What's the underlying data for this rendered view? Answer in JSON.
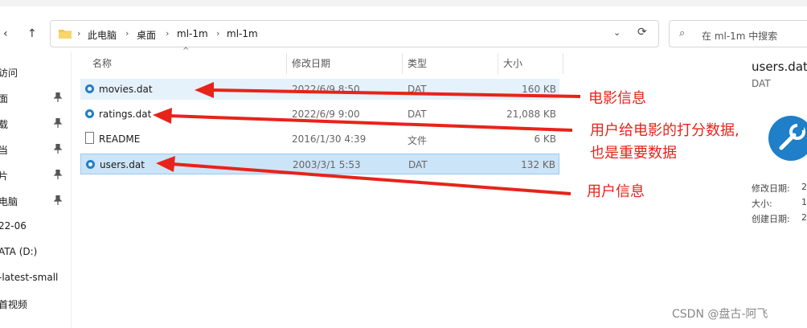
{
  "address": {
    "crumbs": [
      "此电脑",
      "桌面",
      "ml-1m",
      "ml-1m"
    ],
    "separator": "›",
    "search_placeholder": "在 ml-1m 中搜索"
  },
  "nav": {
    "back_glyph": "‹",
    "up_glyph": "↑",
    "dropdown_glyph": "⌄",
    "refresh_glyph": "⟳",
    "search_glyph": "⌕"
  },
  "sidebar": {
    "items": [
      {
        "label": "访问",
        "pinned": false
      },
      {
        "label": "面",
        "pinned": true
      },
      {
        "label": "载",
        "pinned": true
      },
      {
        "label": "当",
        "pinned": true
      },
      {
        "label": "片",
        "pinned": true
      },
      {
        "label": "电脑",
        "pinned": true
      },
      {
        "label": "22-06",
        "pinned": false
      },
      {
        "label": "ATA (D:)",
        "pinned": false
      },
      {
        "label": "-latest-small",
        "pinned": false
      },
      {
        "label": "首视频",
        "pinned": false
      }
    ]
  },
  "columns": {
    "name": "名称",
    "date": "修改日期",
    "type": "类型",
    "size": "大小",
    "sort_glyph": "^"
  },
  "files": [
    {
      "name": "movies.dat",
      "date": "2022/6/9 8:50",
      "type": "DAT",
      "size": "160 KB",
      "icon": "dat-file-icon",
      "state": "hover"
    },
    {
      "name": "ratings.dat",
      "date": "2022/6/9 9:00",
      "type": "DAT",
      "size": "21,088 KB",
      "icon": "dat-file-icon",
      "state": "normal"
    },
    {
      "name": "README",
      "date": "2016/1/30 4:39",
      "type": "文件",
      "size": "6 KB",
      "icon": "document-icon",
      "state": "normal"
    },
    {
      "name": "users.dat",
      "date": "2003/3/1 5:53",
      "type": "DAT",
      "size": "132 KB",
      "icon": "dat-file-icon",
      "state": "selected"
    }
  ],
  "details": {
    "title": "users.dat",
    "type": "DAT",
    "props": [
      {
        "label": "修改日期:",
        "value": "2"
      },
      {
        "label": "大小:",
        "value": "1"
      },
      {
        "label": "创建日期:",
        "value": "2"
      }
    ]
  },
  "annotations": {
    "movies": "电影信息",
    "ratings_line1": "用户给电影的打分数据,",
    "ratings_line2": "也是重要数据",
    "users": "用户信息"
  },
  "watermark": "CSDN @盘古-阿飞",
  "colors": {
    "annotation_red": "#e8231a",
    "selection_blue": "#cce4f7",
    "hover_blue": "#e5f1fb",
    "file_icon_blue": "#1f7fc8",
    "folder_yellow": "#f4c542"
  }
}
